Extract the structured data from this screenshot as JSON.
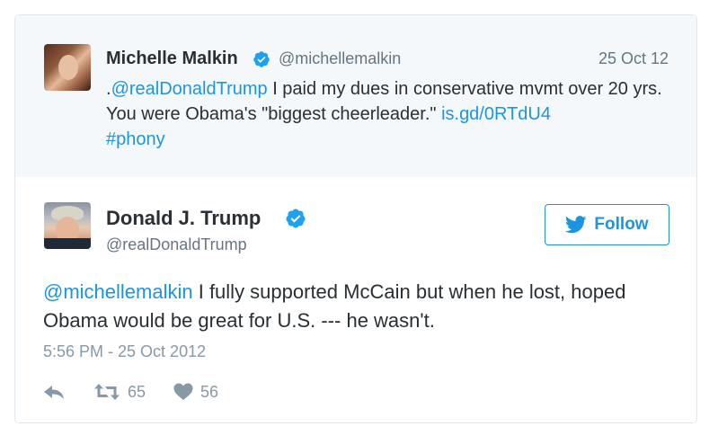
{
  "quoted_tweet": {
    "display_name": "Michelle Malkin",
    "handle": "@michellemalkin",
    "date": "25 Oct 12",
    "text_prefix": ".",
    "mention": "@realDonaldTrump",
    "text_body": " I paid my dues in conservative mvmt over 20 yrs. You were Obama's \"biggest cheerleader.\" ",
    "link": "is.gd/0RTdU4",
    "hashtag": "#phony",
    "verified_icon": "verified-badge-icon"
  },
  "main_tweet": {
    "display_name": "Donald J. Trump",
    "handle": "@realDonaldTrump",
    "follow_label": "Follow",
    "mention": "@michellemalkin",
    "text_body": " I fully supported McCain but when he lost, hoped Obama would be great for U.S. --- he wasn't.",
    "timestamp": "5:56 PM - 25 Oct 2012",
    "retweet_count": "65",
    "like_count": "56",
    "verified_icon": "verified-badge-icon"
  },
  "colors": {
    "accent": "#1b95e0",
    "text": "#292f33",
    "muted": "#66757f",
    "quoted_bg": "#f5f8fa"
  }
}
